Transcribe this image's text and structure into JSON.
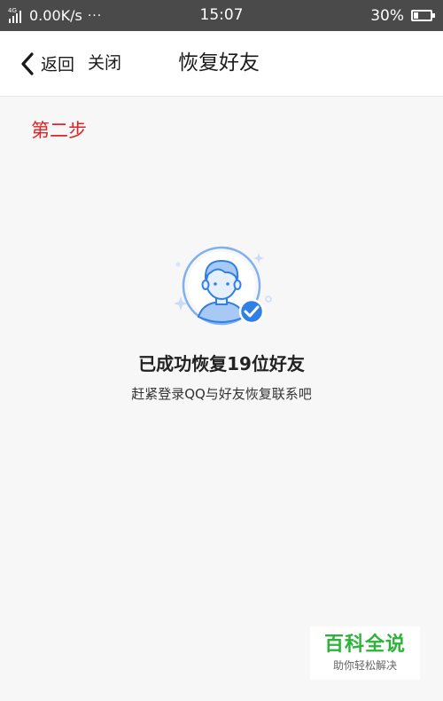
{
  "status_bar": {
    "network_type": "4G",
    "speed": "0.00K/s",
    "more": "···",
    "time": "15:07",
    "battery_text": "30%",
    "battery_level": 0.3
  },
  "nav": {
    "back_label": "返回",
    "close_label": "关闭",
    "title": "恢复好友"
  },
  "content": {
    "step_label": "第二步",
    "success_title": "已成功恢复19位好友",
    "success_subtitle": "赶紧登录QQ与好友恢复联系吧"
  },
  "watermark": {
    "title": "百科全说",
    "subtitle": "助你轻松解决"
  },
  "colors": {
    "accent_blue": "#2f7fe6",
    "step_red": "#e02424",
    "watermark_green": "#2cb43a"
  },
  "icons": [
    "signal-icon",
    "battery-icon",
    "back-chevron-icon",
    "avatar-check-icon"
  ]
}
